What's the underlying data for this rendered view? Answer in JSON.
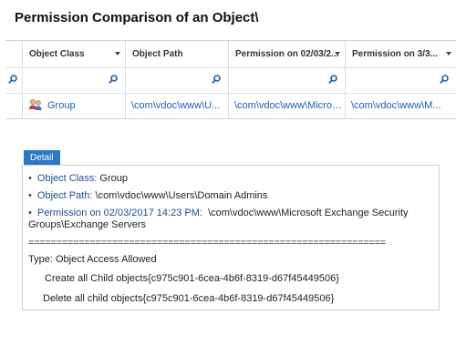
{
  "page": {
    "title": "Permission Comparison of an Object\\"
  },
  "grid": {
    "columns": [
      {
        "label": "Object Class"
      },
      {
        "label": "Object Path"
      },
      {
        "label": "Permission on 02/03/2..."
      },
      {
        "label": "Permission on 3/3..."
      }
    ],
    "row": {
      "object_class": "Group",
      "object_path": "\\com\\vdoc\\www\\U...",
      "perm_a": "\\com\\vdoc\\www\\Micros...",
      "perm_b": "\\com\\vdoc\\www\\M..."
    }
  },
  "detail": {
    "tab_label": "Detail",
    "object_class_label": "Object Class:",
    "object_class_value": "Group",
    "object_path_label": "Object Path:",
    "object_path_value": "\\com\\vdoc\\www\\Users\\Domain Admins",
    "permission_label": "Permission on 02/03/2017 14:23 PM:",
    "permission_value": "\\com\\vdoc\\www\\Microsoft Exchange Security Groups\\Exchange Servers",
    "separator": "================================================================",
    "type_line": "Type: Object Access Allowed",
    "perm_lines": [
      "Create all Child objects{c975c901-6cea-4b6f-8319-d67f45449506}",
      "Delete all child objects{c975c901-6cea-4b6f-8319-d67f45449506}"
    ]
  }
}
